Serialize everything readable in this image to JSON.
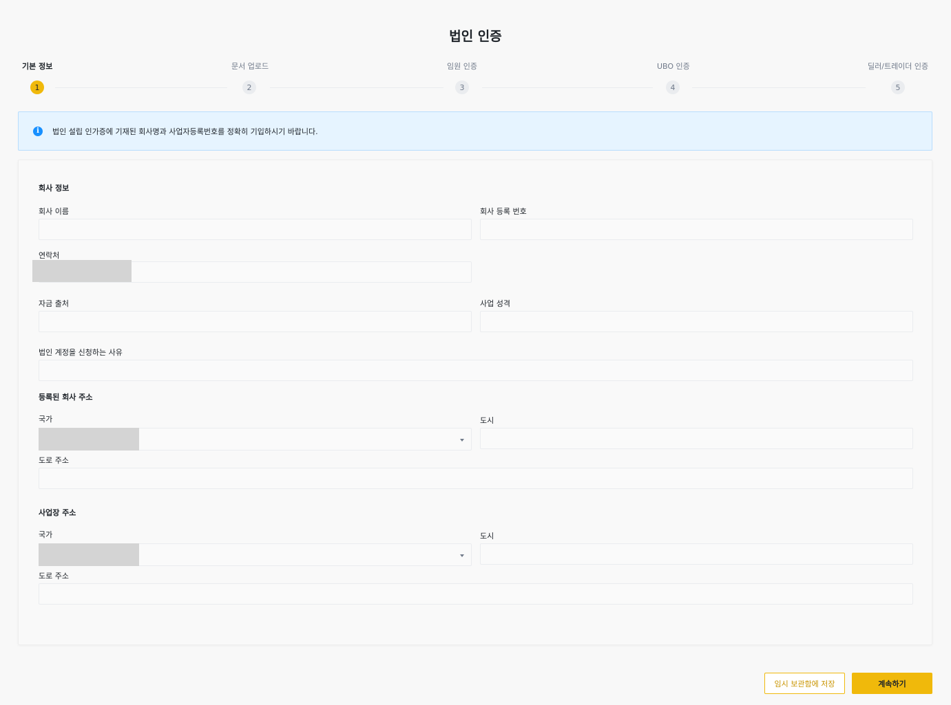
{
  "page": {
    "title": "법인 인증"
  },
  "stepper": {
    "steps": [
      {
        "label": "기본 정보",
        "number": "1",
        "active": true
      },
      {
        "label": "문서 업로드",
        "number": "2",
        "active": false
      },
      {
        "label": "임원 인증",
        "number": "3",
        "active": false
      },
      {
        "label": "UBO 인증",
        "number": "4",
        "active": false
      },
      {
        "label": "딜러/트레이더 인증",
        "number": "5",
        "active": false
      }
    ]
  },
  "info_banner": {
    "icon": "info-icon",
    "text": "법인 설립 인가증에 기재된 회사명과 사업자등록번호를 정확히 기입하시기 바랍니다."
  },
  "form": {
    "company_section": {
      "title": "회사 정보",
      "company_name": {
        "label": "회사 이름",
        "value": ""
      },
      "registration_number": {
        "label": "회사 등록 번호",
        "value": ""
      },
      "contact": {
        "label": "연락처",
        "value": ""
      },
      "source_of_funds": {
        "label": "자금 출처",
        "value": ""
      },
      "business_nature": {
        "label": "사업 성격",
        "value": ""
      },
      "reason": {
        "label": "법인 계정을 신청하는 사유",
        "value": ""
      }
    },
    "registered_address": {
      "title": "등록된 회사 주소",
      "country": {
        "label": "국가",
        "value": ""
      },
      "city": {
        "label": "도시",
        "value": ""
      },
      "street": {
        "label": "도로 주소",
        "value": ""
      }
    },
    "business_address": {
      "title": "사업장 주소",
      "country": {
        "label": "국가",
        "value": ""
      },
      "city": {
        "label": "도시",
        "value": ""
      },
      "street": {
        "label": "도로 주소",
        "value": ""
      }
    }
  },
  "footer": {
    "save_draft_label": "임시 보관함에 저장",
    "continue_label": "계속하기"
  },
  "colors": {
    "accent": "#f0b90b",
    "info_background": "#e6f4ff",
    "info_icon": "#1890ff"
  }
}
